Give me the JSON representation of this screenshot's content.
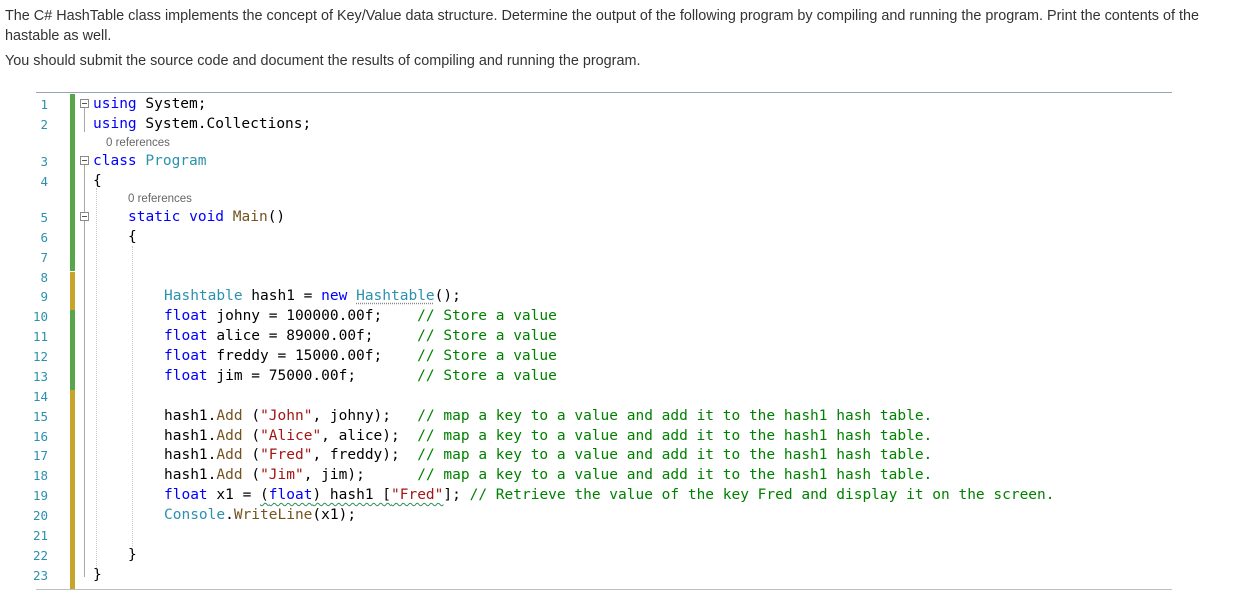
{
  "question": {
    "paragraph1": "The C# HashTable class implements the concept of Key/Value data structure. Determine the output of the following program by compiling and running the program. Print the contents of the hastable as well.",
    "paragraph2": "You should submit the source code and document the results of compiling and running the program."
  },
  "editor": {
    "line_numbers": [
      "1",
      "2",
      "3",
      "4",
      "5",
      "6",
      "7",
      "8",
      "9",
      "10",
      "11",
      "12",
      "13",
      "14",
      "15",
      "16",
      "17",
      "18",
      "19",
      "20",
      "21",
      "22",
      "23"
    ],
    "codelens_class": "0 references",
    "codelens_main": "0 references",
    "tokens": {
      "using": "using",
      "system": " System;",
      "system_collections": " System.Collections;",
      "class": "class",
      "program": " Program",
      "open_brace": "{",
      "close_brace": "}",
      "static_void": "static void",
      "main": " Main",
      "parens": "()",
      "hashtable_type": "Hashtable",
      "hash1_decl": " hash1 = ",
      "new_kw": "new",
      "hashtable_ctor": "Hashtable",
      "ctor_end": "();",
      "float": "float",
      "johny_decl": " johny = 100000.00f;    ",
      "alice_decl": " alice = 89000.00f;     ",
      "freddy_decl": " freddy = 15000.00f;    ",
      "jim_decl": " jim = 75000.00f;       ",
      "store_comment": "// Store a value",
      "hash1_add": "hash1.",
      "add": "Add",
      "open_paren": " (",
      "str_john": "\"John\"",
      "arg_johny": ", johny);   ",
      "str_alice": "\"Alice\"",
      "arg_alice": ", alice);  ",
      "str_fred": "\"Fred\"",
      "arg_freddy": ", freddy);  ",
      "str_jim": "\"Jim\"",
      "arg_jim": ", jim);      ",
      "map_comment": "// map a key to a value and add it to the hash1 hash table.",
      "x1_decl": " x1 = ",
      "cast_open": "(",
      "cast_type": "float",
      "cast_rest": ") hash1 [",
      "index_close": "];",
      "retrieve_comment": " // Retrieve the value of the key Fred and display it on the screen.",
      "console": "Console",
      "dot": ".",
      "writeline": "WriteLine",
      "writeline_args": "(x1);"
    }
  }
}
